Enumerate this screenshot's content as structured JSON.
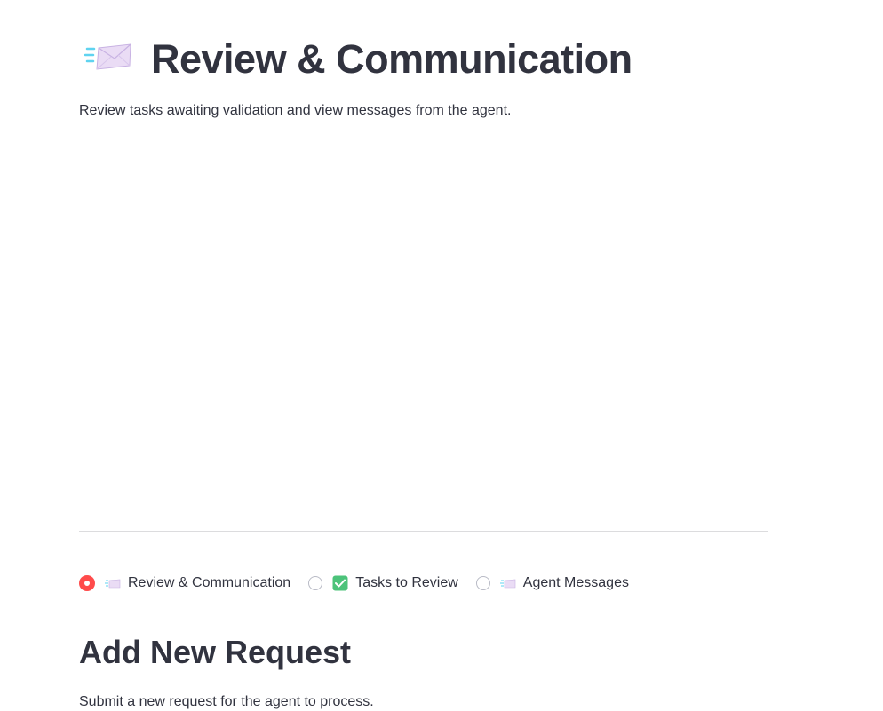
{
  "header": {
    "emoji_icon": "incoming-envelope-icon",
    "title": "Review & Communication",
    "subtitle": "Review tasks awaiting validation and view messages from the agent."
  },
  "nav_radio": {
    "selected_index": 0,
    "accent_color": "#ff4b4b",
    "options": [
      {
        "icon": "incoming-envelope-icon",
        "label": "Review & Communication"
      },
      {
        "icon": "check-mark-button-icon",
        "label": "Tasks to Review"
      },
      {
        "icon": "incoming-envelope-icon",
        "label": "Agent Messages"
      }
    ]
  },
  "section": {
    "title": "Add New Request",
    "subtitle": "Submit a new request for the agent to process."
  }
}
